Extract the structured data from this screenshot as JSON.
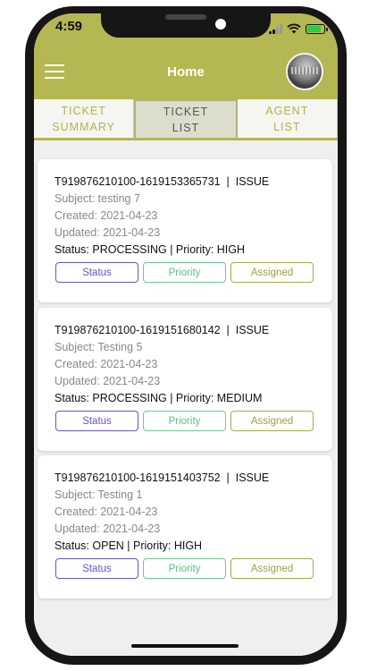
{
  "status_bar": {
    "time": "4:59"
  },
  "app_bar": {
    "title": "Home"
  },
  "tabs": [
    {
      "line1": "TICKET",
      "line2": "SUMMARY",
      "active": false
    },
    {
      "line1": "TICKET",
      "line2": "LIST",
      "active": true
    },
    {
      "line1": "AGENT",
      "line2": "LIST",
      "active": false
    }
  ],
  "tickets": [
    {
      "id": "T919876210100-1619153365731",
      "type": "ISSUE",
      "subject": "Subject: testing 7",
      "created": "Created: 2021-04-23",
      "updated": "Updated: 2021-04-23",
      "status_line": "Status: PROCESSING | Priority: HIGH"
    },
    {
      "id": "T919876210100-1619151680142",
      "type": "ISSUE",
      "subject": "Subject: Testing 5",
      "created": "Created: 2021-04-23",
      "updated": "Updated: 2021-04-23",
      "status_line": "Status: PROCESSING | Priority: MEDIUM"
    },
    {
      "id": "T919876210100-1619151403752",
      "type": "ISSUE",
      "subject": "Subject: Testing 1",
      "created": "Created: 2021-04-23",
      "updated": "Updated: 2021-04-23",
      "status_line": "Status: OPEN | Priority: HIGH"
    }
  ],
  "buttons": {
    "status": "Status",
    "priority": "Priority",
    "assigned": "Assigned"
  },
  "colors": {
    "accent": "#b5b752",
    "status_chip": "#6b52c6",
    "priority_chip": "#5dbf7e",
    "assigned_chip": "#9ea045"
  }
}
